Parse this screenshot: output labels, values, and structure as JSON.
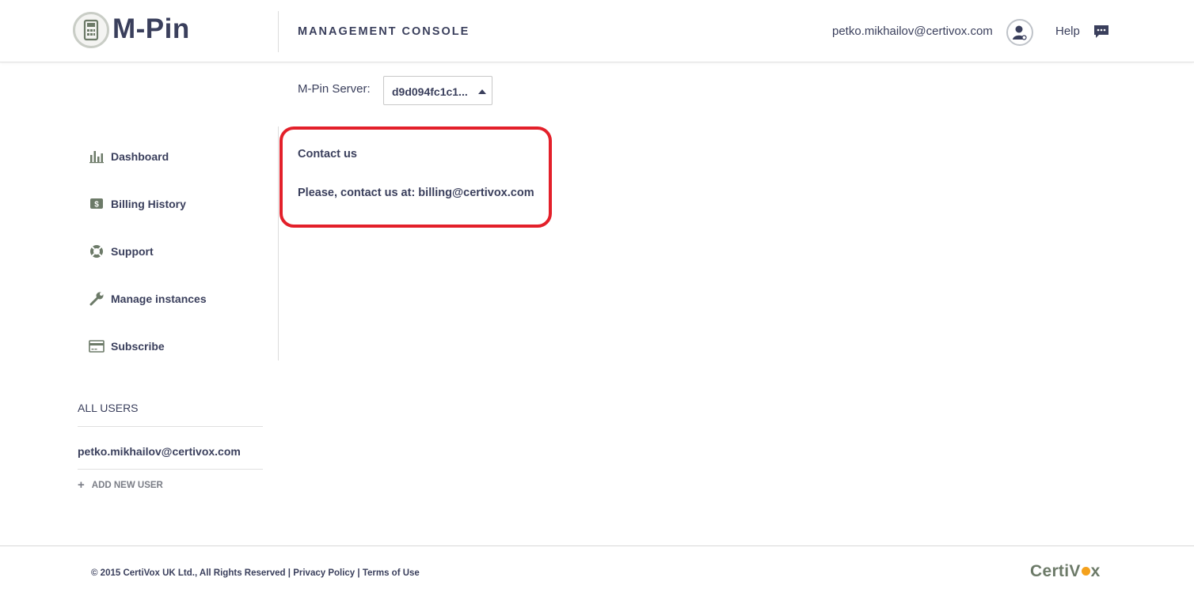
{
  "header": {
    "logo_text": "M-Pin",
    "console_title": "MANAGEMENT CONSOLE",
    "user_email": "petko.mikhailov@certivox.com",
    "help_label": "Help",
    "icons": [
      "calculator-icon",
      "user-icon",
      "chat-icon"
    ]
  },
  "server": {
    "label": "M-Pin Server:",
    "selected_value": "d9d094fc1c1...",
    "icons": [
      "caret-up-icon"
    ]
  },
  "contact": {
    "title": "Contact us",
    "body": "Please, contact us at: billing@certivox.com",
    "highlight_color": "#e3202a"
  },
  "sidebar": {
    "items": [
      {
        "label": "Dashboard",
        "icon": "bar-chart-icon"
      },
      {
        "label": "Billing History",
        "icon": "dollar-icon"
      },
      {
        "label": "Support",
        "icon": "lifebuoy-icon"
      },
      {
        "label": "Manage instances",
        "icon": "wrench-icon"
      },
      {
        "label": "Subscribe",
        "icon": "credit-card-icon"
      }
    ]
  },
  "users": {
    "heading": "ALL USERS",
    "list": [
      "petko.mikhailov@certivox.com"
    ],
    "add_label": "ADD NEW USER",
    "add_icon": "plus-icon"
  },
  "footer": {
    "copyright": "© 2015 CertiVox UK Ltd., All Rights Reserved",
    "separator": "|",
    "privacy": "Privacy Policy",
    "terms": "Terms of Use",
    "brand_left": "CertiV",
    "brand_right": "x"
  },
  "colors": {
    "text": "#3a3f5c",
    "accent_orange": "#f4a11c",
    "brand_green": "#6c7a68"
  }
}
